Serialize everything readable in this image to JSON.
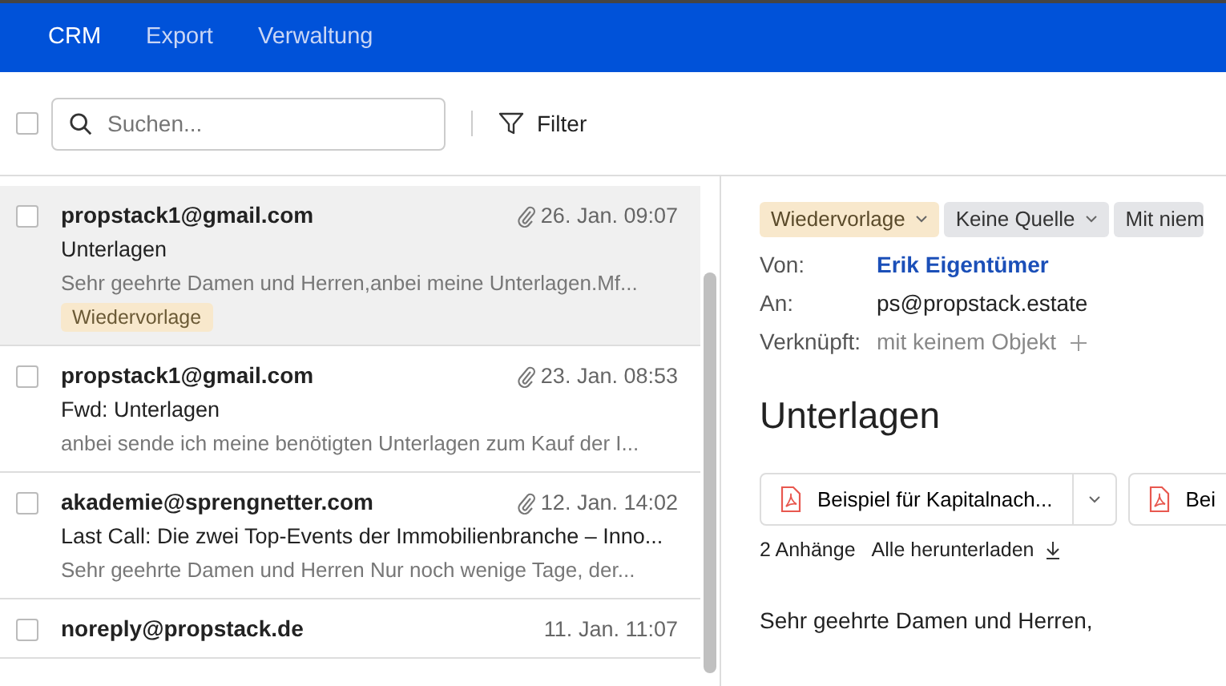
{
  "navbar": {
    "items": [
      {
        "label": "CRM",
        "selected": true
      },
      {
        "label": "Export",
        "selected": false
      },
      {
        "label": "Verwaltung",
        "selected": false
      }
    ]
  },
  "toolbar": {
    "select_all_checked": false,
    "search": {
      "placeholder": "Suchen..."
    },
    "filter": "Filter"
  },
  "messages": [
    {
      "sender": "propstack1@gmail.com",
      "date": "26. Jan. 09:07",
      "subject": "Unterlagen",
      "preview": "Sehr geehrte Damen und Herren,anbei meine Unterlagen.Mf...",
      "tag": "Wiedervorlage",
      "attachment": true,
      "selected": true,
      "checked": false
    },
    {
      "sender": "propstack1@gmail.com",
      "date": "23. Jan. 08:53",
      "subject": "Fwd: Unterlagen",
      "preview": "anbei sende ich meine benötigten Unterlagen zum Kauf der I...",
      "attachment": true,
      "selected": false,
      "checked": false
    },
    {
      "sender": "akademie@sprengnetter.com",
      "date": "12. Jan. 14:02",
      "subject": "Last Call: Die zwei Top-Events der Immobilienbranche – Inno...",
      "preview": "Sehr geehrte Damen und Herren Nur noch wenige Tage, der...",
      "attachment": true,
      "selected": false,
      "checked": false
    },
    {
      "sender": "noreply@propstack.de",
      "date": "11. Jan. 11:07",
      "attachment": false,
      "selected": false,
      "checked": false
    }
  ],
  "detail": {
    "tags": [
      {
        "label": "Wiedervorlage",
        "kind": "status"
      },
      {
        "label": "Keine Quelle",
        "kind": "source"
      },
      {
        "label": "Mit niem",
        "kind": "plain"
      }
    ],
    "fields": [
      {
        "label": "Von:",
        "value": "Erik Eigentümer",
        "kind": "link"
      },
      {
        "label": "An:",
        "value": "ps@propstack.estate",
        "kind": "text"
      },
      {
        "label": "Verknüpft:",
        "value": "mit keinem Objekt",
        "kind": "add"
      }
    ],
    "title": "Unterlagen",
    "attachments": [
      {
        "name": "Beispiel für Kapitalnach..."
      },
      {
        "name": "Bei"
      }
    ],
    "attachment_count": "2 Anhänge",
    "download_all": "Alle herunterladen",
    "body": "Sehr geehrte Damen und Herren,"
  }
}
